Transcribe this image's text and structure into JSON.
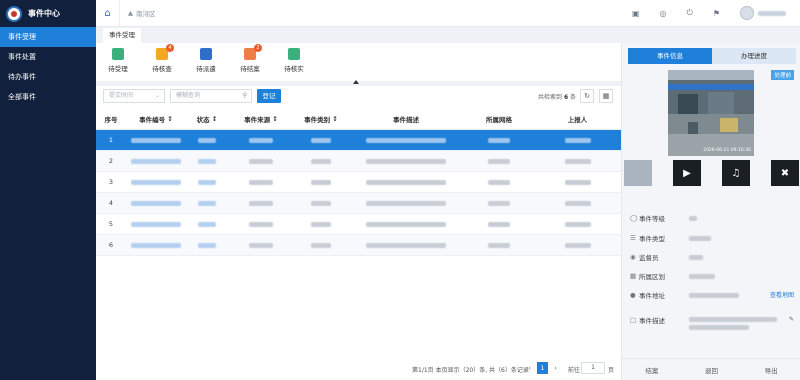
{
  "app": {
    "title": "事件中心"
  },
  "sidebar": {
    "items": [
      {
        "label": "事件受理",
        "active": true
      },
      {
        "label": "事件处置",
        "active": false
      },
      {
        "label": "待办事件",
        "active": false
      },
      {
        "label": "全部事件",
        "active": false
      }
    ]
  },
  "topbar": {
    "breadcrumb": "南浔区"
  },
  "tabs": {
    "current": "事件受理"
  },
  "toolbar": {
    "items": [
      {
        "label": "待受理",
        "color": "#3ab07f",
        "badge": ""
      },
      {
        "label": "待核查",
        "color": "#f5a623",
        "badge": "4"
      },
      {
        "label": "待派遣",
        "color": "#2e6fc9",
        "badge": ""
      },
      {
        "label": "待结案",
        "color": "#f07d48",
        "badge": "2"
      },
      {
        "label": "待核实",
        "color": "#3ab07f",
        "badge": ""
      }
    ]
  },
  "search": {
    "date_placeholder": "提交时间",
    "keyword_placeholder": "模糊查询",
    "register_label": "登记",
    "total_prefix": "共检索到",
    "total_count": "6",
    "total_suffix": "条"
  },
  "table": {
    "columns": [
      "序号",
      "事件编号",
      "状态",
      "事件来源",
      "事件类别",
      "事件描述",
      "所属网格",
      "上报人"
    ],
    "rows": [
      {
        "index": "1",
        "selected": true
      },
      {
        "index": "2",
        "selected": false
      },
      {
        "index": "3",
        "selected": false
      },
      {
        "index": "4",
        "selected": false
      },
      {
        "index": "5",
        "selected": false
      },
      {
        "index": "6",
        "selected": false
      }
    ]
  },
  "pager": {
    "summary": "第1/1页 本页显示（20）条, 共（6）条记录",
    "current_page": "1",
    "goto_label": "前往",
    "goto_value": "1",
    "page_unit": "页"
  },
  "detail": {
    "tab_info": "事件信息",
    "tab_progress": "办理进度",
    "photo_tag": "处理前",
    "photo_timestamp": "2026-06-21 09:16:36",
    "fields": [
      {
        "icon": "shield-icon",
        "label": "事件等级"
      },
      {
        "icon": "list-icon",
        "label": "事件类型"
      },
      {
        "icon": "eye-icon",
        "label": "监督员"
      },
      {
        "icon": "map-icon",
        "label": "所属区划"
      },
      {
        "icon": "user-icon",
        "label": "事件地址"
      },
      {
        "icon": "doc-icon",
        "label": "事件描述"
      }
    ],
    "map_link": "查看地图",
    "footer": [
      "结案",
      "退回",
      "导出"
    ]
  }
}
